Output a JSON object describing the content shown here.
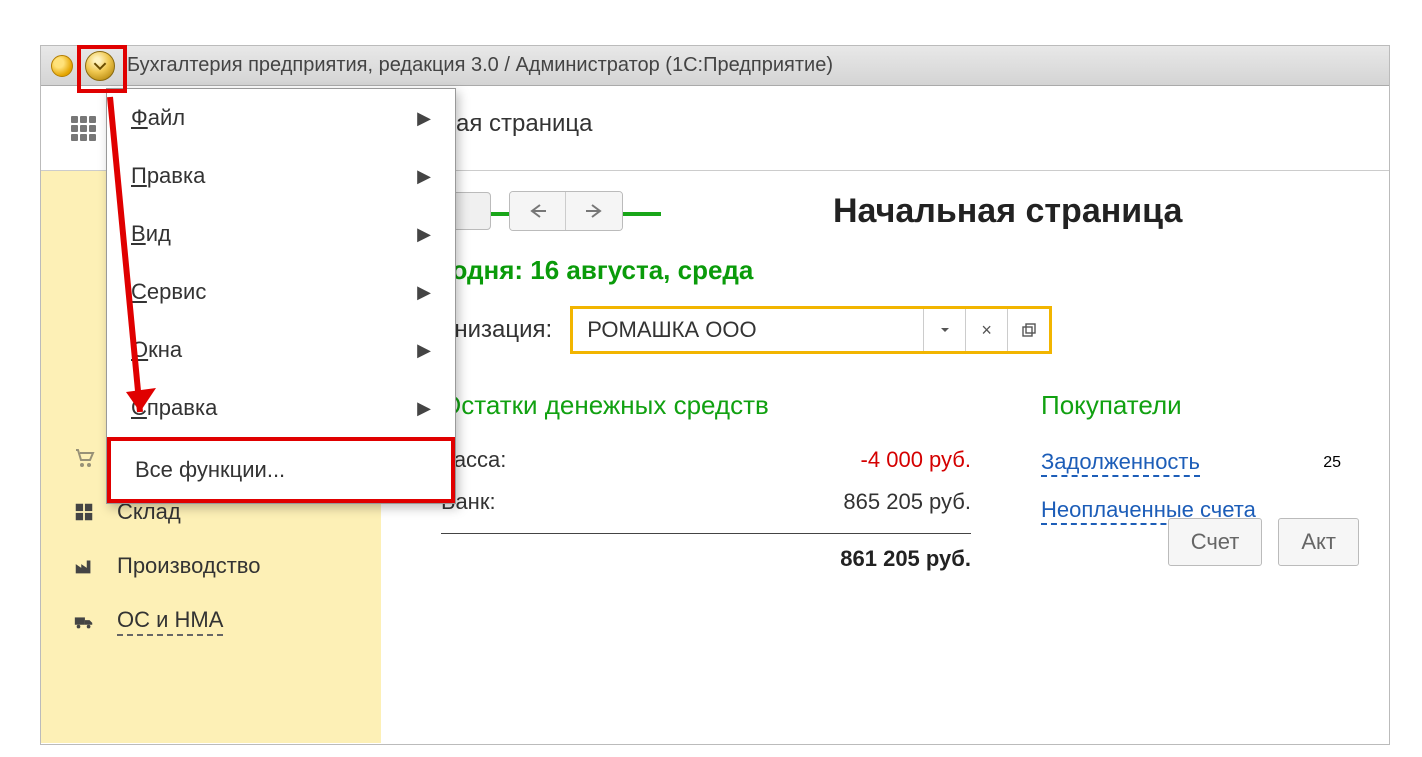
{
  "window": {
    "title": "Бухгалтерия предприятия, редакция 3.0 / Администратор  (1С:Предприятие)"
  },
  "tab": {
    "visible_fragment": "ая страница"
  },
  "menu": {
    "items": [
      {
        "label": "Файл",
        "has_submenu": true
      },
      {
        "label": "Правка",
        "has_submenu": true
      },
      {
        "label": "Вид",
        "has_submenu": true
      },
      {
        "label": "Сервис",
        "has_submenu": true
      },
      {
        "label": "Окна",
        "has_submenu": true
      },
      {
        "label": "Справка",
        "has_submenu": true
      },
      {
        "label": "Все функции...",
        "has_submenu": false
      }
    ]
  },
  "sidebar": {
    "items": [
      {
        "label": "Покупки",
        "icon": "cart"
      },
      {
        "label": "Склад",
        "icon": "blocks"
      },
      {
        "label": "Производство",
        "icon": "factory"
      },
      {
        "label": "ОС и НМА",
        "icon": "truck",
        "dashed": true
      }
    ]
  },
  "page": {
    "title": "Начальная страница",
    "today_fragment": "годня: 16 августа, среда",
    "org_label_fragment": "анизация:",
    "org_value": "РОМАШКА ООО"
  },
  "balances": {
    "title": "Остатки денежных средств",
    "rows": [
      {
        "label": "Касса:",
        "value": "-4 000 руб.",
        "negative": true
      },
      {
        "label": "Банк:",
        "value": "865 205 руб.",
        "negative": false
      }
    ],
    "total": "861 205 руб."
  },
  "buyers": {
    "title": "Покупатели",
    "rows": [
      {
        "label": "Задолженность",
        "value": "25"
      },
      {
        "label": "Неоплаченные счета",
        "value": ""
      }
    ]
  },
  "footer_buttons": [
    "Счет",
    "Акт"
  ]
}
